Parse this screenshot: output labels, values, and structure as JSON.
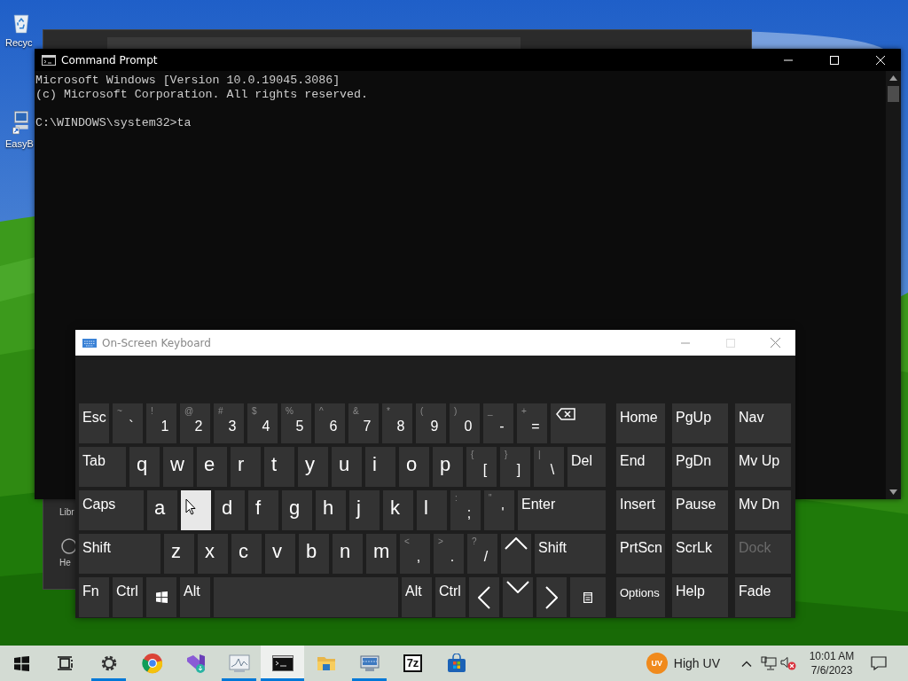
{
  "desktop": {
    "icons": [
      {
        "kind": "recycle-bin",
        "label": "Recyc"
      },
      {
        "kind": "shortcut",
        "label": "EasyB"
      }
    ]
  },
  "background_window": {
    "sidebar_items": [
      {
        "kind": "text",
        "label": "Libr"
      },
      {
        "kind": "help",
        "label": "He"
      }
    ]
  },
  "command_prompt": {
    "title": "Command Prompt",
    "output": [
      "Microsoft Windows [Version 10.0.19045.3086]",
      "(c) Microsoft Corporation. All rights reserved."
    ],
    "prompt": "C:\\WINDOWS\\system32>ta"
  },
  "keyboard": {
    "title": "On-Screen Keyboard",
    "rows": [
      {
        "keys": [
          {
            "kind": "word",
            "label": "Esc",
            "hovered": false
          },
          {
            "kind": "pair",
            "shift": "~",
            "label": "`",
            "hovered": false
          },
          {
            "kind": "pair",
            "shift": "!",
            "label": "1",
            "hovered": false
          },
          {
            "kind": "pair",
            "shift": "@",
            "label": "2",
            "hovered": false
          },
          {
            "kind": "pair",
            "shift": "#",
            "label": "3",
            "hovered": false
          },
          {
            "kind": "pair",
            "shift": "$",
            "label": "4",
            "hovered": false
          },
          {
            "kind": "pair",
            "shift": "%",
            "label": "5",
            "hovered": false
          },
          {
            "kind": "pair",
            "shift": "^",
            "label": "6",
            "hovered": false
          },
          {
            "kind": "pair",
            "shift": "&",
            "label": "7",
            "hovered": false
          },
          {
            "kind": "pair",
            "shift": "*",
            "label": "8",
            "hovered": false
          },
          {
            "kind": "pair",
            "shift": "(",
            "label": "9",
            "hovered": false
          },
          {
            "kind": "pair",
            "shift": ")",
            "label": "0",
            "hovered": false
          },
          {
            "kind": "pair",
            "shift": "_",
            "label": "-",
            "hovered": false
          },
          {
            "kind": "pair",
            "shift": "+",
            "label": "=",
            "hovered": false
          },
          {
            "kind": "backspace",
            "hovered": false
          }
        ]
      },
      {
        "keys": [
          {
            "kind": "word",
            "label": "Tab",
            "hovered": false
          },
          {
            "kind": "letter",
            "label": "q",
            "hovered": false
          },
          {
            "kind": "letter",
            "label": "w",
            "hovered": false
          },
          {
            "kind": "letter",
            "label": "e",
            "hovered": false
          },
          {
            "kind": "letter",
            "label": "r",
            "hovered": false
          },
          {
            "kind": "letter",
            "label": "t",
            "hovered": false
          },
          {
            "kind": "letter",
            "label": "y",
            "hovered": false
          },
          {
            "kind": "letter",
            "label": "u",
            "hovered": false
          },
          {
            "kind": "letter",
            "label": "i",
            "hovered": false
          },
          {
            "kind": "letter",
            "label": "o",
            "hovered": false
          },
          {
            "kind": "letter",
            "label": "p",
            "hovered": false
          },
          {
            "kind": "pair",
            "shift": "{",
            "label": "[",
            "hovered": false
          },
          {
            "kind": "pair",
            "shift": "}",
            "label": "]",
            "hovered": false
          },
          {
            "kind": "pair",
            "shift": "|",
            "label": "\\",
            "hovered": false
          },
          {
            "kind": "word",
            "label": "Del",
            "hovered": false
          }
        ]
      },
      {
        "keys": [
          {
            "kind": "word",
            "label": "Caps",
            "hovered": false
          },
          {
            "kind": "letter",
            "label": "a",
            "hovered": false
          },
          {
            "kind": "letter",
            "hovered": true
          },
          {
            "kind": "letter",
            "label": "d",
            "hovered": false
          },
          {
            "kind": "letter",
            "label": "f",
            "hovered": false
          },
          {
            "kind": "letter",
            "label": "g",
            "hovered": false
          },
          {
            "kind": "letter",
            "label": "h",
            "hovered": false
          },
          {
            "kind": "letter",
            "label": "j",
            "hovered": false
          },
          {
            "kind": "letter",
            "label": "k",
            "hovered": false
          },
          {
            "kind": "letter",
            "label": "l",
            "hovered": false
          },
          {
            "kind": "pair",
            "shift": ":",
            "label": ";",
            "hovered": false
          },
          {
            "kind": "pair",
            "shift": "\"",
            "label": "'",
            "hovered": false
          },
          {
            "kind": "word",
            "label": "Enter",
            "hovered": false
          }
        ]
      },
      {
        "keys": [
          {
            "kind": "word",
            "label": "Shift",
            "hovered": false
          },
          {
            "kind": "letter",
            "label": "z",
            "hovered": false
          },
          {
            "kind": "letter",
            "label": "x",
            "hovered": false
          },
          {
            "kind": "letter",
            "label": "c",
            "hovered": false
          },
          {
            "kind": "letter",
            "label": "v",
            "hovered": false
          },
          {
            "kind": "letter",
            "label": "b",
            "hovered": false
          },
          {
            "kind": "letter",
            "label": "n",
            "hovered": false
          },
          {
            "kind": "letter",
            "label": "m",
            "hovered": false
          },
          {
            "kind": "pair",
            "shift": "<",
            "label": ",",
            "hovered": false
          },
          {
            "kind": "pair",
            "shift": ">",
            "label": ".",
            "hovered": false
          },
          {
            "kind": "pair",
            "shift": "?",
            "label": "/",
            "hovered": false
          },
          {
            "kind": "arrow-up",
            "hovered": false
          },
          {
            "kind": "word",
            "label": "Shift",
            "hovered": false
          }
        ]
      },
      {
        "keys": [
          {
            "kind": "word",
            "label": "Fn",
            "hovered": false
          },
          {
            "kind": "word",
            "label": "Ctrl",
            "hovered": false
          },
          {
            "kind": "windows",
            "hovered": false
          },
          {
            "kind": "word",
            "label": "Alt",
            "hovered": false
          },
          {
            "kind": "space",
            "hovered": false
          },
          {
            "kind": "word",
            "label": "Alt",
            "hovered": false
          },
          {
            "kind": "word",
            "label": "Ctrl",
            "hovered": false
          },
          {
            "kind": "arrow-left",
            "hovered": false
          },
          {
            "kind": "arrow-down",
            "hovered": false
          },
          {
            "kind": "arrow-right",
            "hovered": false
          },
          {
            "kind": "menu",
            "hovered": false
          }
        ]
      }
    ],
    "nav_keys": [
      {
        "kind": "word",
        "label": "Home",
        "disabled": false
      },
      {
        "kind": "word",
        "label": "PgUp",
        "disabled": false
      },
      {
        "kind": "word",
        "label": "Nav",
        "disabled": false
      },
      {
        "kind": "word",
        "label": "End",
        "disabled": false
      },
      {
        "kind": "word",
        "label": "PgDn",
        "disabled": false
      },
      {
        "kind": "word",
        "label": "Mv Up",
        "disabled": false
      },
      {
        "kind": "word",
        "label": "Insert",
        "disabled": false
      },
      {
        "kind": "word",
        "label": "Pause",
        "disabled": false
      },
      {
        "kind": "word",
        "label": "Mv Dn",
        "disabled": false
      },
      {
        "kind": "word",
        "label": "PrtScn",
        "disabled": false
      },
      {
        "kind": "word",
        "label": "ScrLk",
        "disabled": false
      },
      {
        "kind": "word",
        "label": "Dock",
        "disabled": true
      },
      {
        "kind": "word-small",
        "label": "Options",
        "disabled": false
      },
      {
        "kind": "word",
        "label": "Help",
        "disabled": false
      },
      {
        "kind": "word",
        "label": "Fade",
        "disabled": false
      }
    ]
  },
  "taskbar": {
    "apps": [
      {
        "kind": "start",
        "running": false,
        "selected": false
      },
      {
        "kind": "task-view",
        "running": false,
        "selected": false
      },
      {
        "kind": "settings",
        "running": true,
        "selected": false
      },
      {
        "kind": "browser",
        "running": false,
        "selected": false
      },
      {
        "kind": "studio",
        "running": false,
        "selected": false
      },
      {
        "kind": "monitor-chart",
        "running": true,
        "selected": false
      },
      {
        "kind": "terminal",
        "running": true,
        "selected": true
      },
      {
        "kind": "folder",
        "running": false,
        "selected": false
      },
      {
        "kind": "remote",
        "running": true,
        "selected": false
      },
      {
        "kind": "archive",
        "label": "7z",
        "running": false,
        "selected": false
      },
      {
        "kind": "store",
        "running": false,
        "selected": false
      }
    ],
    "tray": {
      "weather_badge": "UV",
      "weather": "High UV",
      "volume_muted": true,
      "time": "10:01 AM",
      "date": "7/6/2023"
    }
  }
}
